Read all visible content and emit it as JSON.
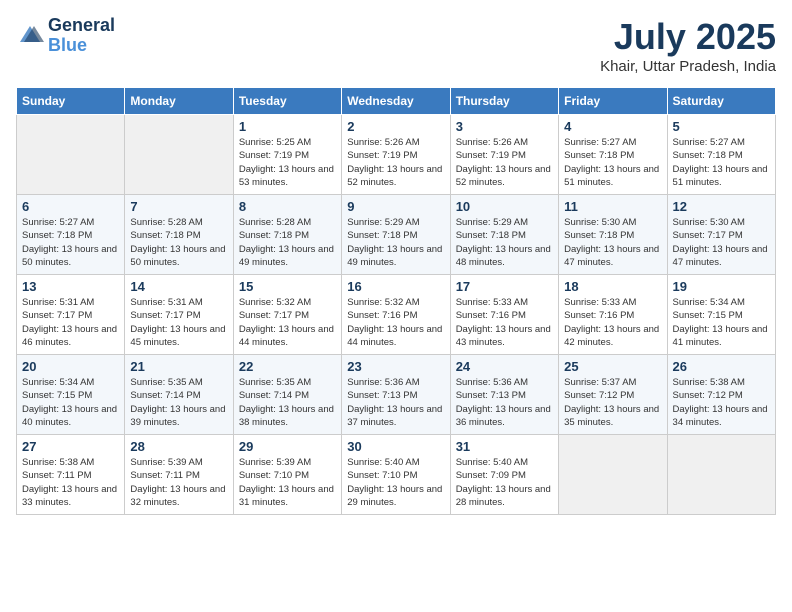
{
  "header": {
    "logo_line1": "General",
    "logo_line2": "Blue",
    "month": "July 2025",
    "location": "Khair, Uttar Pradesh, India"
  },
  "weekdays": [
    "Sunday",
    "Monday",
    "Tuesday",
    "Wednesday",
    "Thursday",
    "Friday",
    "Saturday"
  ],
  "weeks": [
    [
      {
        "day": null
      },
      {
        "day": null
      },
      {
        "day": "1",
        "sunrise": "5:25 AM",
        "sunset": "7:19 PM",
        "daylight": "13 hours and 53 minutes."
      },
      {
        "day": "2",
        "sunrise": "5:26 AM",
        "sunset": "7:19 PM",
        "daylight": "13 hours and 52 minutes."
      },
      {
        "day": "3",
        "sunrise": "5:26 AM",
        "sunset": "7:19 PM",
        "daylight": "13 hours and 52 minutes."
      },
      {
        "day": "4",
        "sunrise": "5:27 AM",
        "sunset": "7:18 PM",
        "daylight": "13 hours and 51 minutes."
      },
      {
        "day": "5",
        "sunrise": "5:27 AM",
        "sunset": "7:18 PM",
        "daylight": "13 hours and 51 minutes."
      }
    ],
    [
      {
        "day": "6",
        "sunrise": "5:27 AM",
        "sunset": "7:18 PM",
        "daylight": "13 hours and 50 minutes."
      },
      {
        "day": "7",
        "sunrise": "5:28 AM",
        "sunset": "7:18 PM",
        "daylight": "13 hours and 50 minutes."
      },
      {
        "day": "8",
        "sunrise": "5:28 AM",
        "sunset": "7:18 PM",
        "daylight": "13 hours and 49 minutes."
      },
      {
        "day": "9",
        "sunrise": "5:29 AM",
        "sunset": "7:18 PM",
        "daylight": "13 hours and 49 minutes."
      },
      {
        "day": "10",
        "sunrise": "5:29 AM",
        "sunset": "7:18 PM",
        "daylight": "13 hours and 48 minutes."
      },
      {
        "day": "11",
        "sunrise": "5:30 AM",
        "sunset": "7:18 PM",
        "daylight": "13 hours and 47 minutes."
      },
      {
        "day": "12",
        "sunrise": "5:30 AM",
        "sunset": "7:17 PM",
        "daylight": "13 hours and 47 minutes."
      }
    ],
    [
      {
        "day": "13",
        "sunrise": "5:31 AM",
        "sunset": "7:17 PM",
        "daylight": "13 hours and 46 minutes."
      },
      {
        "day": "14",
        "sunrise": "5:31 AM",
        "sunset": "7:17 PM",
        "daylight": "13 hours and 45 minutes."
      },
      {
        "day": "15",
        "sunrise": "5:32 AM",
        "sunset": "7:17 PM",
        "daylight": "13 hours and 44 minutes."
      },
      {
        "day": "16",
        "sunrise": "5:32 AM",
        "sunset": "7:16 PM",
        "daylight": "13 hours and 44 minutes."
      },
      {
        "day": "17",
        "sunrise": "5:33 AM",
        "sunset": "7:16 PM",
        "daylight": "13 hours and 43 minutes."
      },
      {
        "day": "18",
        "sunrise": "5:33 AM",
        "sunset": "7:16 PM",
        "daylight": "13 hours and 42 minutes."
      },
      {
        "day": "19",
        "sunrise": "5:34 AM",
        "sunset": "7:15 PM",
        "daylight": "13 hours and 41 minutes."
      }
    ],
    [
      {
        "day": "20",
        "sunrise": "5:34 AM",
        "sunset": "7:15 PM",
        "daylight": "13 hours and 40 minutes."
      },
      {
        "day": "21",
        "sunrise": "5:35 AM",
        "sunset": "7:14 PM",
        "daylight": "13 hours and 39 minutes."
      },
      {
        "day": "22",
        "sunrise": "5:35 AM",
        "sunset": "7:14 PM",
        "daylight": "13 hours and 38 minutes."
      },
      {
        "day": "23",
        "sunrise": "5:36 AM",
        "sunset": "7:13 PM",
        "daylight": "13 hours and 37 minutes."
      },
      {
        "day": "24",
        "sunrise": "5:36 AM",
        "sunset": "7:13 PM",
        "daylight": "13 hours and 36 minutes."
      },
      {
        "day": "25",
        "sunrise": "5:37 AM",
        "sunset": "7:12 PM",
        "daylight": "13 hours and 35 minutes."
      },
      {
        "day": "26",
        "sunrise": "5:38 AM",
        "sunset": "7:12 PM",
        "daylight": "13 hours and 34 minutes."
      }
    ],
    [
      {
        "day": "27",
        "sunrise": "5:38 AM",
        "sunset": "7:11 PM",
        "daylight": "13 hours and 33 minutes."
      },
      {
        "day": "28",
        "sunrise": "5:39 AM",
        "sunset": "7:11 PM",
        "daylight": "13 hours and 32 minutes."
      },
      {
        "day": "29",
        "sunrise": "5:39 AM",
        "sunset": "7:10 PM",
        "daylight": "13 hours and 31 minutes."
      },
      {
        "day": "30",
        "sunrise": "5:40 AM",
        "sunset": "7:10 PM",
        "daylight": "13 hours and 29 minutes."
      },
      {
        "day": "31",
        "sunrise": "5:40 AM",
        "sunset": "7:09 PM",
        "daylight": "13 hours and 28 minutes."
      },
      {
        "day": null
      },
      {
        "day": null
      }
    ]
  ],
  "labels": {
    "sunrise": "Sunrise:",
    "sunset": "Sunset:",
    "daylight": "Daylight:"
  }
}
